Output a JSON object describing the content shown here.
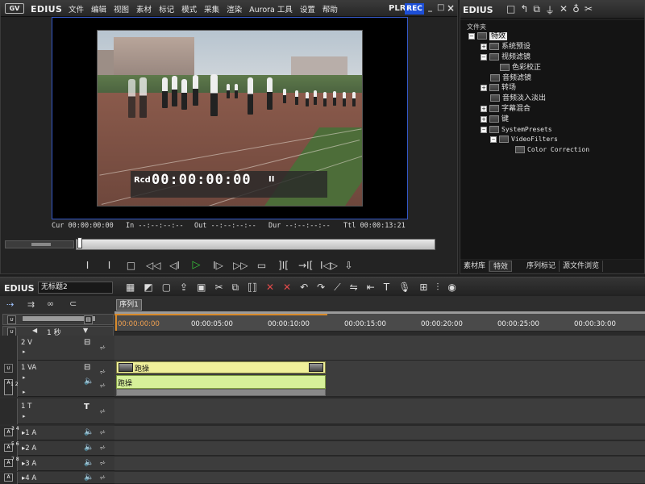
{
  "player": {
    "logo": "GV",
    "app_name": "EDIUS",
    "menu": [
      "文件",
      "编辑",
      "视图",
      "素材",
      "标记",
      "模式",
      "采集",
      "渲染",
      "Aurora 工具",
      "设置",
      "帮助"
    ],
    "plr_label": "PLR",
    "rec_label": "REC",
    "minimize_glyph": "_",
    "restore_glyph": "□",
    "close_glyph": "×",
    "overlay": {
      "label": "Rcd",
      "timecode": "00:00:00:00",
      "pause_glyph": "II"
    },
    "timecodes": {
      "cur_label": "Cur",
      "cur": "00:00:00:00",
      "in_label": "In",
      "in": "--:--:--:--",
      "out_label": "Out",
      "out": "--:--:--:--",
      "dur_label": "Dur",
      "dur": "--:--:--:--",
      "ttl_label": "Ttl",
      "ttl": "00:00:13:21"
    },
    "transport": [
      "I",
      "I",
      "□",
      "◁◁",
      "◁I",
      "▷",
      "I▷",
      "▷▷",
      "▭",
      "]I[",
      "→I[",
      "I◁▷",
      "⇩"
    ]
  },
  "bin": {
    "app_name": "EDIUS",
    "tools": [
      "□",
      "↰",
      "⧉",
      "⏚",
      "✕",
      "♁",
      "✂"
    ],
    "tree_header": "文件夹",
    "tree": [
      {
        "label": "特效",
        "selected": true
      },
      {
        "label": "系统预设"
      },
      {
        "label": "视频滤镜"
      },
      {
        "label": "色彩校正"
      },
      {
        "label": "音频滤镜"
      },
      {
        "label": "转场"
      },
      {
        "label": "音频淡入淡出"
      },
      {
        "label": "字幕混合"
      },
      {
        "label": "键"
      },
      {
        "label": "SystemPresets"
      },
      {
        "label": "VideoFilters"
      },
      {
        "label": "Color Correction"
      }
    ],
    "tabs": [
      "素材库",
      "特效",
      "序列标记",
      "源文件浏览"
    ]
  },
  "timeline": {
    "app_name": "EDIUS",
    "project_name": "无标题2",
    "tools": [
      "▦",
      "◩",
      "▢",
      "⇪",
      "▣",
      "✂",
      "⧉",
      "⟦⟧",
      "✕",
      "✕",
      "↶",
      "↷",
      "⟋",
      "⇋",
      "⇤",
      "T",
      "🎙",
      "⊞",
      "⫶",
      "◉"
    ],
    "sequence_tab": "序列1",
    "scale_label": "1 秒",
    "ruler": [
      "00:00:00:00",
      "00:00:05:00",
      "00:00:10:00",
      "00:00:15:00",
      "00:00:20:00",
      "00:00:25:00",
      "00:00:30:00"
    ],
    "tracks": [
      {
        "name": "2 V",
        "type": "V"
      },
      {
        "name": "1 VA",
        "type": "VA",
        "badge_a": "A",
        "badge_n": "1 2"
      },
      {
        "name": "1 T",
        "type": "T",
        "glyph": "T"
      },
      {
        "name": "1 A",
        "type": "A",
        "badge_a": "A",
        "badge_n": "3 4"
      },
      {
        "name": "2 A",
        "type": "A",
        "badge_a": "A",
        "badge_n": "5 6"
      },
      {
        "name": "3 A",
        "type": "A",
        "badge_a": "A",
        "badge_n": "7 8"
      },
      {
        "name": "4 A",
        "type": "A",
        "badge_a": "A",
        "badge_n": ""
      }
    ],
    "clip": {
      "video_label": "跑操",
      "audio_label": "跑操"
    }
  }
}
